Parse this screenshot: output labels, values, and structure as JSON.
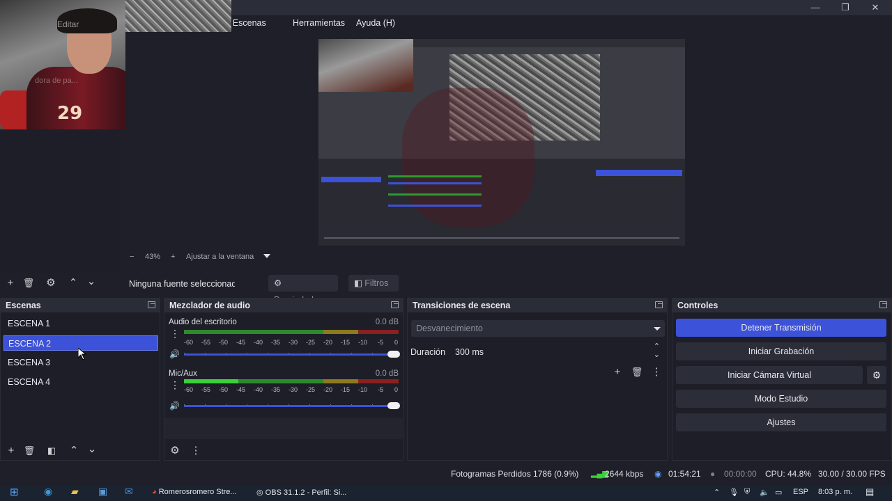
{
  "window": {
    "minimize": "—",
    "restore": "❐",
    "close": "✕"
  },
  "menu": {
    "items": [
      "Editar",
      "ción de Escenas",
      "Herramientas",
      "Ayuda (H)"
    ]
  },
  "webcam": {
    "jersey_number": "29",
    "ghost_text": "dora de pa..."
  },
  "preview": {
    "zoom_minus": "−",
    "zoom": "43%",
    "zoom_plus": "+",
    "fit_label": "Ajustar a la ventana"
  },
  "source_toolbar": {
    "no_source": "Ninguna fuente seleccionada",
    "properties": "Propiedades",
    "filters": "Filtros"
  },
  "scenes": {
    "title": "Escenas",
    "items": [
      "ESCENA 1",
      "ESCENA 2",
      "ESCENA 3",
      "ESCENA 4"
    ],
    "active_index": 1
  },
  "mixer": {
    "title": "Mezclador de audio",
    "channels": [
      {
        "name": "Audio del escritorio",
        "db": "0.0 dB",
        "level": 0.0
      },
      {
        "name": "Mic/Aux",
        "db": "0.0 dB",
        "level": 0.25
      }
    ],
    "ticks": [
      "-60",
      "-55",
      "-50",
      "-45",
      "-40",
      "-35",
      "-30",
      "-25",
      "-20",
      "-15",
      "-10",
      "-5",
      "0"
    ]
  },
  "transitions": {
    "title": "Transiciones de escena",
    "selected": "Desvanecimiento",
    "duration_label": "Duración",
    "duration_value": "300 ms"
  },
  "controls": {
    "title": "Controles",
    "buttons": [
      "Detener Transmisión",
      "Iniciar Grabación",
      "Iniciar Cámara Virtual",
      "Modo Estudio",
      "Ajustes"
    ]
  },
  "status": {
    "dropped": "Fotogramas Perdidos 1786 (0.9%)",
    "bitrate": "2644 kbps",
    "stream_time": "01:54:21",
    "rec_time": "00:00:00",
    "cpu": "CPU: 44.8%",
    "fps": "30.00 / 30.00 FPS"
  },
  "taskbar": {
    "chrome": "Romerosromero Stre...",
    "obs": "OBS 31.1.2 - Perfil: Si...",
    "lang": "ESP",
    "time": "8:03 p. m."
  },
  "colors": {
    "accent": "#3c52d8",
    "background": "#1e1f28",
    "panel": "#2b2d38"
  }
}
